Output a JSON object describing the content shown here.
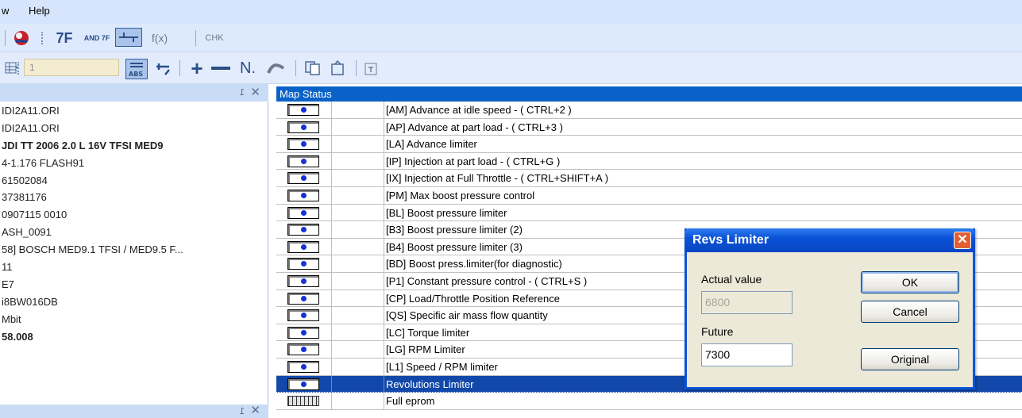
{
  "menubar": {
    "items": [
      {
        "label": "w"
      },
      {
        "label": "Help"
      }
    ]
  },
  "toolbar1": {
    "buttons": [
      "7F",
      "AND 7F",
      "f(x)",
      "CHK"
    ]
  },
  "toolbar2": {
    "page_value": "1",
    "buttons": [
      "N."
    ]
  },
  "left_panel": {
    "rows": [
      {
        "text": "IDI2A11.ORI",
        "bold": false
      },
      {
        "text": "IDI2A11.ORI",
        "bold": false
      },
      {
        "text": "JDI TT 2006 2.0 L 16V TFSI MED9",
        "bold": true
      },
      {
        "text": "4-1.176 FLASH91",
        "bold": false
      },
      {
        "text": "61502084",
        "bold": false
      },
      {
        "text": "37381176",
        "bold": false
      },
      {
        "text": "0907115 0010",
        "bold": false
      },
      {
        "text": "ASH_0091",
        "bold": false
      },
      {
        "text": "58] BOSCH MED9.1 TFSI / MED9.5 F...",
        "bold": false
      },
      {
        "text": "11",
        "bold": false
      },
      {
        "text": "E7",
        "bold": false
      },
      {
        "text": "i8BW016DB",
        "bold": false
      },
      {
        "text": " Mbit",
        "bold": false
      },
      {
        "text": "58.008",
        "bold": true
      }
    ]
  },
  "map_status": {
    "header": "Map Status",
    "rows": [
      {
        "label": "[AM] Advance at idle speed - ( CTRL+2 )",
        "icon": "dot"
      },
      {
        "label": "[AP] Advance at part load - ( CTRL+3 )",
        "icon": "dot"
      },
      {
        "label": "[LA] Advance limiter",
        "icon": "dot"
      },
      {
        "label": "[IP] Injection at part load - ( CTRL+G )",
        "icon": "dot"
      },
      {
        "label": "[IX] Injection at Full Throttle - ( CTRL+SHIFT+A )",
        "icon": "dot"
      },
      {
        "label": "[PM] Max boost pressure control",
        "icon": "dot"
      },
      {
        "label": "[BL] Boost pressure limiter",
        "icon": "dot"
      },
      {
        "label": "[B3] Boost pressure limiter (2)",
        "icon": "dot"
      },
      {
        "label": "[B4] Boost pressure limiter (3)",
        "icon": "dot"
      },
      {
        "label": "[BD] Boost press.limiter(for diagnostic)",
        "icon": "dot"
      },
      {
        "label": "[P1] Constant pressure control - ( CTRL+S )",
        "icon": "dot"
      },
      {
        "label": "[CP] Load/Throttle Position Reference",
        "icon": "dot"
      },
      {
        "label": "[QS] Specific air mass flow quantity",
        "icon": "dot"
      },
      {
        "label": "[LC] Torque limiter",
        "icon": "dot"
      },
      {
        "label": "[LG] RPM Limiter",
        "icon": "dot"
      },
      {
        "label": "[L1] Speed / RPM limiter",
        "icon": "dot"
      },
      {
        "label": "Revolutions Limiter",
        "icon": "dot",
        "selected": true
      },
      {
        "label": "Full eprom",
        "icon": "grid"
      }
    ]
  },
  "dialog": {
    "title": "Revs Limiter",
    "actual_label": "Actual value",
    "actual_value": "6800",
    "future_label": "Future",
    "future_value": "7300",
    "ok_label": "OK",
    "cancel_label": "Cancel",
    "original_label": "Original"
  }
}
